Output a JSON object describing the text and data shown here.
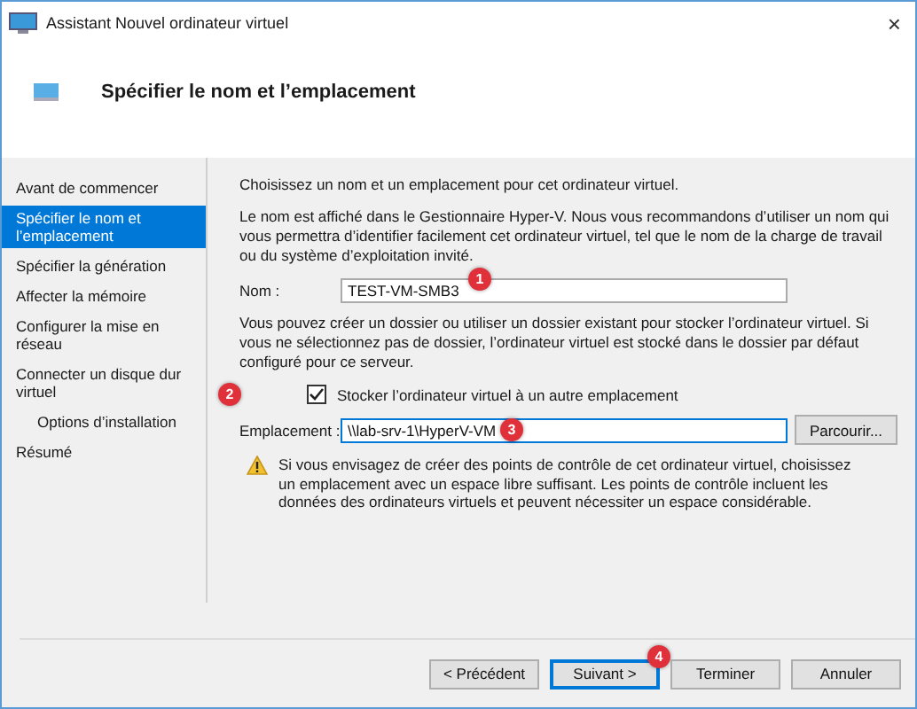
{
  "window": {
    "title": "Assistant Nouvel ordinateur virtuel",
    "close": "×"
  },
  "header": {
    "title": "Spécifier le nom et l’emplacement"
  },
  "sidebar": {
    "items": [
      {
        "label": "Avant de commencer",
        "selected": false
      },
      {
        "label": "Spécifier le nom et l’emplacement",
        "selected": true
      },
      {
        "label": "Spécifier la génération",
        "selected": false
      },
      {
        "label": "Affecter la mémoire",
        "selected": false
      },
      {
        "label": "Configurer la mise en réseau",
        "selected": false
      },
      {
        "label": "Connecter un disque dur virtuel",
        "selected": false,
        "children": [
          {
            "label": "Options d’installation",
            "selected": false
          }
        ]
      },
      {
        "label": "Résumé",
        "selected": false
      }
    ]
  },
  "content": {
    "intro": "Choisissez un nom et un emplacement pour cet ordinateur virtuel.",
    "name_help": "Le nom est affiché dans le Gestionnaire Hyper-V. Nous vous recommandons d’utiliser un nom qui vous permettra d’identifier facilement cet ordinateur virtuel, tel que le nom de la charge de travail ou du système d’exploitation invité.",
    "name_field": {
      "label": "Nom :",
      "value": "TEST-VM-SMB3",
      "badge": "1"
    },
    "folder_help": "Vous pouvez créer un dossier ou utiliser un dossier existant pour stocker l’ordinateur virtuel. Si vous ne sélectionnez pas de dossier, l’ordinateur virtuel est stocké dans le dossier par défaut configuré pour ce serveur.",
    "store_checkbox": {
      "label": "Stocker l’ordinateur virtuel à un autre emplacement",
      "checked": true,
      "badge": "2"
    },
    "location_field": {
      "label": "Emplacement :",
      "value": "\\\\lab-srv-1\\HyperV-VM",
      "badge": "3",
      "browse": "Parcourir..."
    },
    "warning": "Si vous envisagez de créer des points de contrôle de cet ordinateur virtuel, choisissez un emplacement avec un espace libre suffisant. Les points de contrôle incluent les données des ordinateurs virtuels et peuvent nécessiter un espace considérable."
  },
  "buttons": [
    {
      "label": "< Précédent",
      "selected": false
    },
    {
      "label": "Suivant >",
      "selected": true,
      "badge": "4"
    },
    {
      "label": "Terminer",
      "selected": false
    },
    {
      "label": "Annuler",
      "selected": false
    }
  ]
}
